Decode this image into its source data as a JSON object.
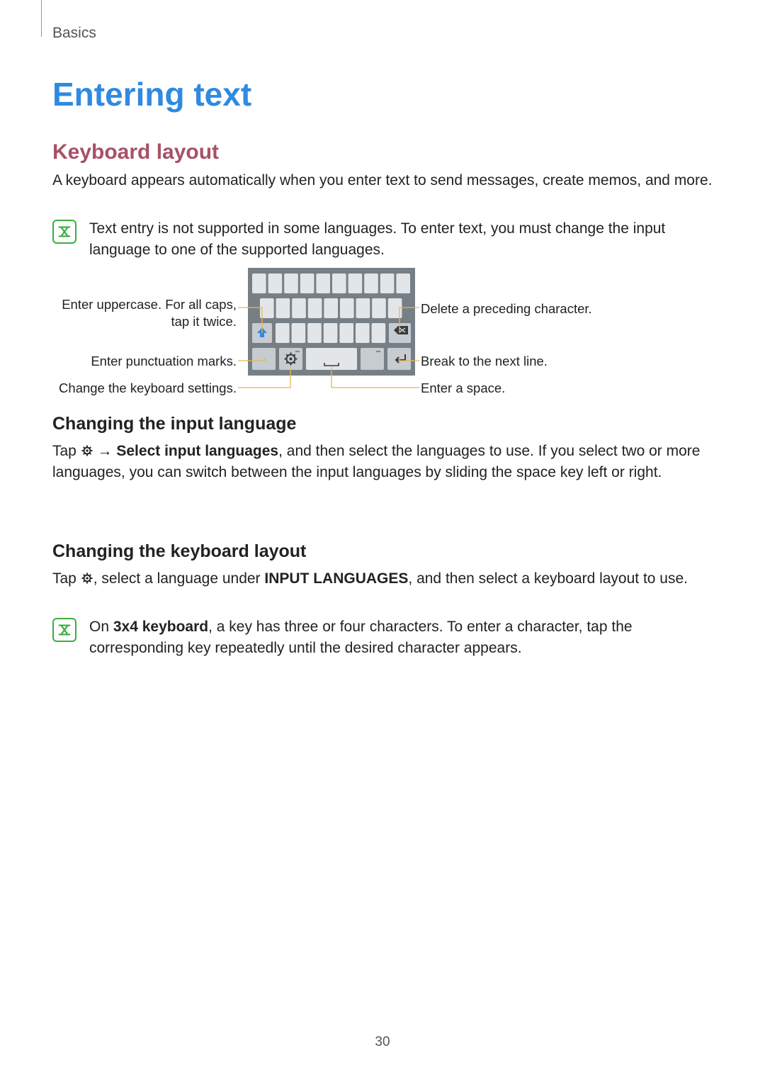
{
  "section_tag": "Basics",
  "h1": "Entering text",
  "h2_keyboard": "Keyboard layout",
  "p_intro": "A keyboard appears automatically when you enter text to send messages, create memos, and more.",
  "note1": "Text entry is not supported in some languages. To enter text, you must change the input language to one of the supported languages.",
  "callouts": {
    "uppercase": "Enter uppercase. For all caps, tap it twice.",
    "punctuation": "Enter punctuation marks.",
    "settings": "Change the keyboard settings.",
    "delete": "Delete a preceding character.",
    "nextline": "Break to the next line.",
    "space": "Enter a space."
  },
  "h3_input_lang": "Changing the input language",
  "p_input_lang_pre": "Tap ",
  "p_input_lang_arrow": " → ",
  "p_input_lang_bold": "Select input languages",
  "p_input_lang_post": ", and then select the languages to use. If you select two or more languages, you can switch between the input languages by sliding the space key left or right.",
  "h3_kb_layout": "Changing the keyboard layout",
  "p_kb_layout_pre": "Tap ",
  "p_kb_layout_mid": ", select a language under ",
  "p_kb_layout_bold": "INPUT LANGUAGES",
  "p_kb_layout_post": ", and then select a keyboard layout to use.",
  "note2_pre": "On ",
  "note2_bold": "3x4 keyboard",
  "note2_post": ", a key has three or four characters. To enter a character, tap the corresponding key repeatedly until the desired character appears.",
  "page_number": "30"
}
